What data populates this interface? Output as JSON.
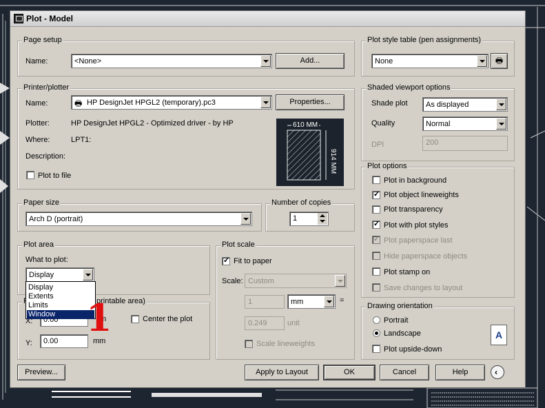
{
  "dialog": {
    "title": "Plot - Model"
  },
  "page_setup": {
    "group_title": "Page setup",
    "name_label": "Name:",
    "name_value": "<None>",
    "add_label": "Add..."
  },
  "printer": {
    "group_title": "Printer/plotter",
    "name_label": "Name:",
    "name_value": "HP DesignJet HPGL2 (temporary).pc3",
    "properties_label": "Properties...",
    "plotter_label": "Plotter:",
    "plotter_value": "HP DesignJet HPGL2 - Optimized driver - by HP",
    "where_label": "Where:",
    "where_value": "LPT1:",
    "description_label": "Description:",
    "plot_to_file_label": "Plot to file",
    "plot_to_file_checked": false,
    "preview_width": "610 MM",
    "preview_height": "914 MM"
  },
  "paper_size": {
    "group_title": "Paper size",
    "value": "Arch D (portrait)"
  },
  "copies": {
    "group_title": "Number of copies",
    "value": "1"
  },
  "plot_area": {
    "group_title": "Plot area",
    "what_label": "What to plot:",
    "selected": "Display",
    "options": [
      "Display",
      "Extents",
      "Limits",
      "Window"
    ],
    "highlighted_option": "Window"
  },
  "plot_offset": {
    "title_start": "P",
    "title_end": "printable area)",
    "x_label": "X:",
    "x_value_fragment": "0.00",
    "x_unit_fragment": "m",
    "y_label": "Y:",
    "y_value": "0.00",
    "y_unit": "mm",
    "center_label": "Center the plot",
    "center_checked": false
  },
  "plot_scale": {
    "group_title": "Plot scale",
    "fit_label": "Fit to paper",
    "fit_checked": true,
    "scale_label": "Scale:",
    "scale_value": "Custom",
    "value1": "1",
    "unit1": "mm",
    "equals": "=",
    "value2": "0.249",
    "unit2": "unit",
    "lineweights_label": "Scale lineweights",
    "lineweights_checked": false
  },
  "plot_style_table": {
    "group_title": "Plot style table (pen assignments)",
    "value": "None"
  },
  "shaded_viewport": {
    "group_title": "Shaded viewport options",
    "shade_label": "Shade plot",
    "shade_value": "As displayed",
    "quality_label": "Quality",
    "quality_value": "Normal",
    "dpi_label": "DPI",
    "dpi_value": "200"
  },
  "plot_options": {
    "group_title": "Plot options",
    "items": [
      {
        "label": "Plot in background",
        "checked": false,
        "enabled": true
      },
      {
        "label": "Plot object lineweights",
        "checked": true,
        "enabled": true
      },
      {
        "label": "Plot transparency",
        "checked": false,
        "enabled": true
      },
      {
        "label": "Plot with plot styles",
        "checked": true,
        "enabled": true
      },
      {
        "label": "Plot paperspace last",
        "checked": true,
        "enabled": false
      },
      {
        "label": "Hide paperspace objects",
        "checked": false,
        "enabled": false
      },
      {
        "label": "Plot stamp on",
        "checked": false,
        "enabled": true
      },
      {
        "label": "Save changes to layout",
        "checked": false,
        "enabled": false
      }
    ]
  },
  "orientation": {
    "group_title": "Drawing orientation",
    "portrait_label": "Portrait",
    "landscape_label": "Landscape",
    "selected": "Landscape",
    "upside_label": "Plot upside-down",
    "upside_checked": false,
    "icon_letter": "A"
  },
  "buttons": {
    "preview": "Preview...",
    "apply": "Apply to Layout",
    "ok": "OK",
    "cancel": "Cancel",
    "help": "Help"
  },
  "annotation": "1",
  "colors": {
    "background": "#1d2530",
    "dialog": "#d4d0c8",
    "highlight": "#0a246a",
    "annotation": "#e01010"
  }
}
